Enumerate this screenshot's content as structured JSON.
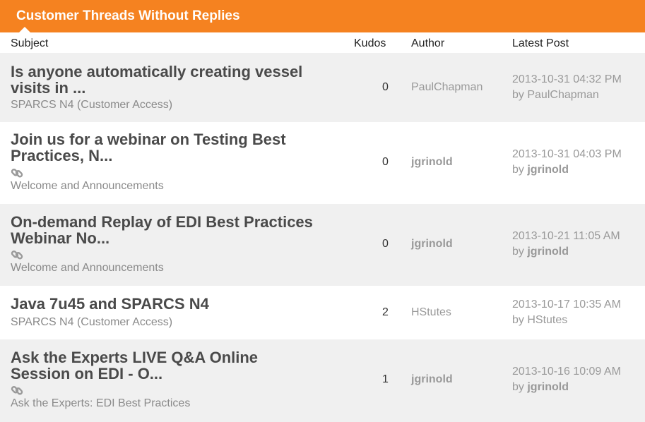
{
  "widget": {
    "title": "Customer Threads Without Replies",
    "columns": {
      "subject": "Subject",
      "kudos": "Kudos",
      "author": "Author",
      "latest": "Latest Post"
    },
    "by_prefix": "by",
    "threads": [
      {
        "subject_line1": "Is anyone automatically creating vessel",
        "subject_line2": "visits in ...",
        "board": "SPARCS N4 (Customer Access)",
        "kudos": "0",
        "author": "PaulChapman",
        "latest_date": "2013-10-31 04:32 PM",
        "latest_by": "PaulChapman",
        "has_link_icon": false
      },
      {
        "subject_line1": "Join us for a webinar on Testing Best",
        "subject_line2": "Practices, N...",
        "board": "Welcome and Announcements",
        "kudos": "0",
        "author": "jgrinold",
        "latest_date": "2013-10-31 04:03 PM",
        "latest_by": "jgrinold",
        "has_link_icon": true
      },
      {
        "subject_line1": "On-demand Replay of EDI Best Practices",
        "subject_line2": "Webinar No...",
        "board": "Welcome and Announcements",
        "kudos": "0",
        "author": "jgrinold",
        "latest_date": "2013-10-21 11:05 AM",
        "latest_by": "jgrinold",
        "has_link_icon": true
      },
      {
        "subject_line1": "Java 7u45 and SPARCS N4",
        "subject_line2": "",
        "board": "SPARCS N4 (Customer Access)",
        "kudos": "2",
        "author": "HStutes",
        "latest_date": "2013-10-17 10:35 AM",
        "latest_by": "HStutes",
        "has_link_icon": false
      },
      {
        "subject_line1": "Ask the Experts LIVE Q&A Online",
        "subject_line2": "Session on EDI - O...",
        "board": "Ask the Experts: EDI Best Practices",
        "kudos": "1",
        "author": "jgrinold",
        "latest_date": "2013-10-16 10:09 AM",
        "latest_by": "jgrinold",
        "has_link_icon": true
      }
    ]
  },
  "colors": {
    "header_bg": "#f58220",
    "row_shaded": "#f0f0f0",
    "muted_text": "#999999"
  },
  "icons": {
    "thread_link": "link-chain-icon"
  }
}
